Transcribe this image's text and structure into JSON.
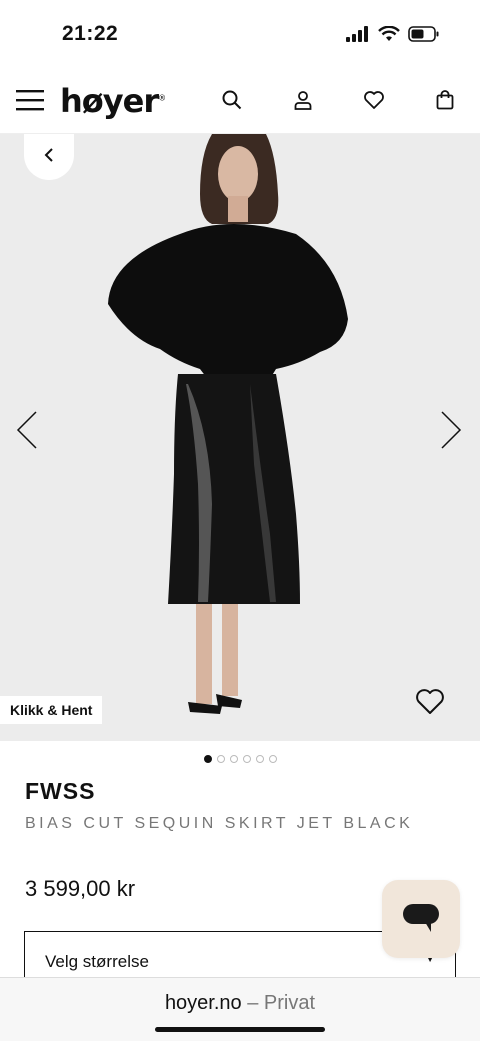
{
  "status_bar": {
    "time": "21:22",
    "icons": [
      "signal-icon",
      "wifi-icon",
      "battery-icon"
    ]
  },
  "header": {
    "logo": "høyer",
    "logo_mark": "®",
    "icons": [
      "menu-icon",
      "search-icon",
      "account-icon",
      "wishlist-icon",
      "bag-icon"
    ]
  },
  "gallery": {
    "pickup_badge": "Klikk & Hent",
    "image_count": 6,
    "active_index": 0,
    "background": "#ececec"
  },
  "product": {
    "brand": "FWSS",
    "name": "BIAS CUT SEQUIN SKIRT JET BLACK",
    "price": "3 599,00 kr"
  },
  "size_select": {
    "placeholder": "Velg størrelse"
  },
  "chat": {
    "icon": "chat-icon",
    "background": "#f1e6da"
  },
  "browser": {
    "domain": "hoyer.no",
    "separator": " – ",
    "mode": "Privat"
  }
}
